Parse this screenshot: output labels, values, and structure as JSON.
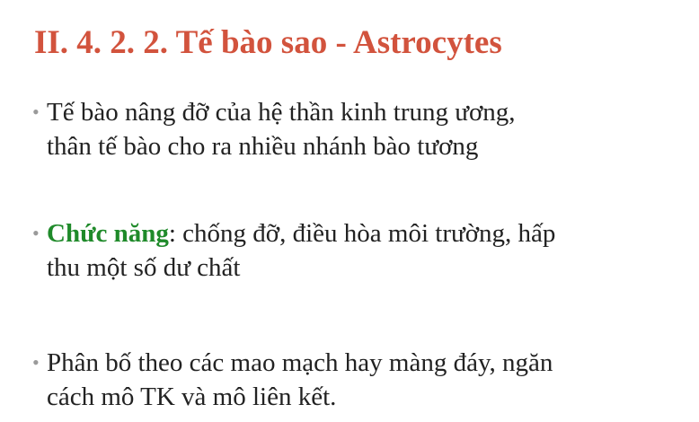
{
  "title": "II. 4. 2. 2. Tế bào sao - Astrocytes",
  "bullets": [
    {
      "marker": "•",
      "lead": "",
      "text": "Tế bào nâng đỡ của hệ thần kinh trung ương,",
      "text2": "thân tế bào cho ra nhiều nhánh bào tương"
    },
    {
      "marker": "•",
      "lead": "Chức năng",
      "text": ": chống đỡ, điều hòa môi trường, hấp",
      "text2": "thu một số dư chất"
    },
    {
      "marker": "•",
      "lead": "",
      "text": "Phân bố theo các mao mạch hay màng đáy, ngăn",
      "text2": "cách mô TK và mô liên kết."
    }
  ],
  "colors": {
    "title": "#d2533d",
    "highlight": "#1f8a2a",
    "body": "#222222",
    "bullet": "#9a9a9a"
  }
}
